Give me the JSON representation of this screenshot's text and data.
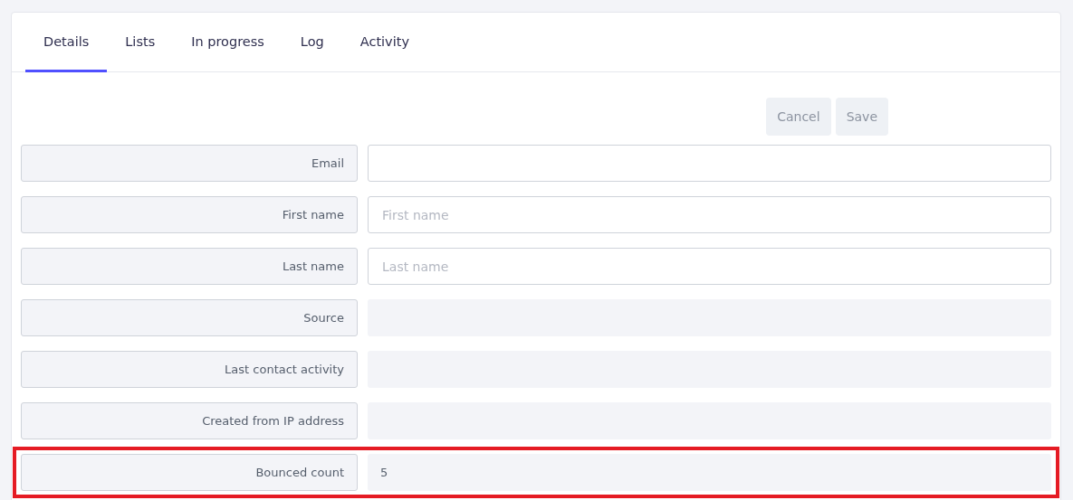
{
  "tabs": [
    {
      "label": "Details",
      "selected": true
    },
    {
      "label": "Lists",
      "selected": false
    },
    {
      "label": "In progress",
      "selected": false
    },
    {
      "label": "Log",
      "selected": false
    },
    {
      "label": "Activity",
      "selected": false
    }
  ],
  "buttons": [
    {
      "label": "Cancel",
      "disabled": true
    },
    {
      "label": "Save",
      "disabled": true
    }
  ],
  "fields": [
    {
      "label": "Email",
      "editable": true,
      "highlighted": false
    },
    {
      "label": "First name",
      "editable": true,
      "placeholder": "First name",
      "highlighted": false
    },
    {
      "label": "Last name",
      "editable": true,
      "placeholder": "Last name",
      "highlighted": false
    },
    {
      "label": "Source",
      "editable": false,
      "highlighted": false
    },
    {
      "label": "Last contact activity",
      "editable": false,
      "highlighted": false
    },
    {
      "label": "Created from IP address",
      "editable": false,
      "highlighted": false
    },
    {
      "label": "Bounced count",
      "editable": false,
      "value": "5",
      "highlighted": true
    }
  ]
}
